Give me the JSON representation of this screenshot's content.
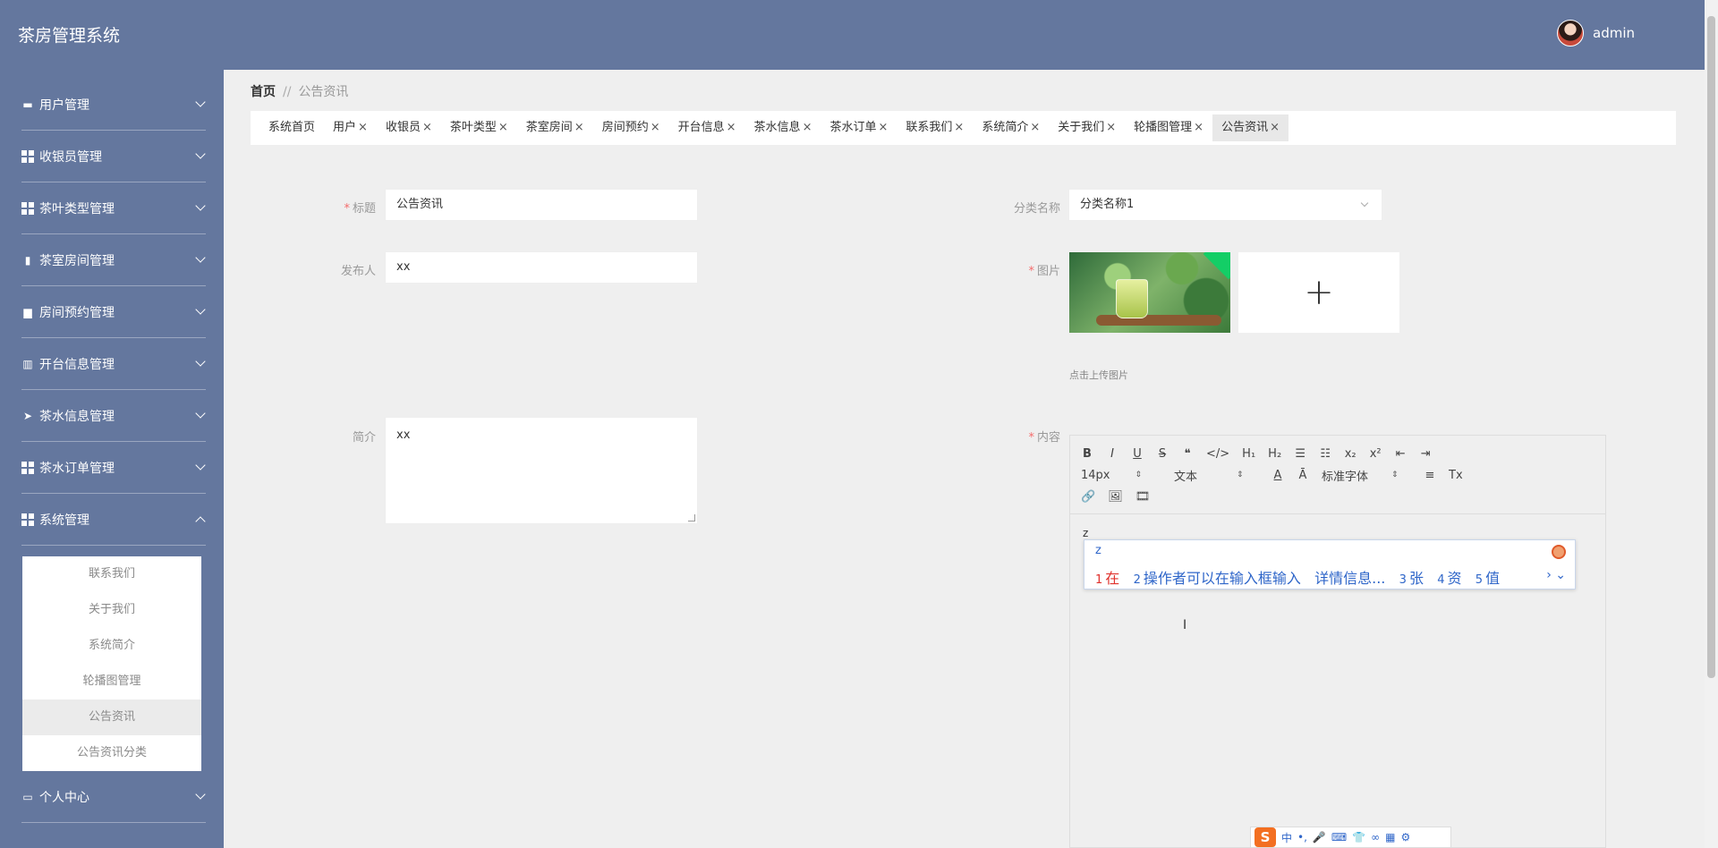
{
  "app": {
    "title": "茶房管理系统"
  },
  "user": {
    "name": "admin"
  },
  "sidebar": {
    "items": [
      {
        "label": "用户管理",
        "icon": "chat-icon"
      },
      {
        "label": "收银员管理",
        "icon": "grid-icon"
      },
      {
        "label": "茶叶类型管理",
        "icon": "grid-icon"
      },
      {
        "label": "茶室房间管理",
        "icon": "bar-chart-icon"
      },
      {
        "label": "房间预约管理",
        "icon": "briefcase-icon"
      },
      {
        "label": "开台信息管理",
        "icon": "books-icon"
      },
      {
        "label": "茶水信息管理",
        "icon": "paper-plane-icon"
      },
      {
        "label": "茶水订单管理",
        "icon": "grid-icon"
      },
      {
        "label": "系统管理",
        "icon": "grid-icon"
      },
      {
        "label": "个人中心",
        "icon": "card-icon"
      }
    ],
    "submenu": [
      "联系我们",
      "关于我们",
      "系统简介",
      "轮播图管理",
      "公告资讯",
      "公告资讯分类"
    ]
  },
  "breadcrumb": {
    "home": "首页",
    "separator": "//",
    "current": "公告资讯"
  },
  "tabs": [
    "系统首页",
    "用户",
    "收银员",
    "茶叶类型",
    "茶室房间",
    "房间预约",
    "开台信息",
    "茶水信息",
    "茶水订单",
    "联系我们",
    "系统简介",
    "关于我们",
    "轮播图管理",
    "公告资讯"
  ],
  "tab_close": "×",
  "form": {
    "title_label": "标题",
    "title_value": "公告资讯",
    "category_label": "分类名称",
    "category_value": "分类名称1",
    "publisher_label": "发布人",
    "publisher_value": "xx",
    "image_label": "图片",
    "upload_tip": "点击上传图片",
    "upload_plus": "+",
    "intro_label": "简介",
    "intro_value": "xx",
    "content_label": "内容",
    "required_mark": "*"
  },
  "editor": {
    "row1": [
      "B",
      "I",
      "U",
      "S",
      "❝",
      "</>",
      "H₁",
      "H₂",
      "☰",
      "☷",
      "x₂",
      "x²",
      "⇤",
      "⇥"
    ],
    "font_size": "14px",
    "format": "文本",
    "font_family": "标准字体",
    "row2_tools": [
      "A",
      "Ā",
      "≡",
      "Tx"
    ],
    "row3": [
      "🔗",
      "🖼",
      "🎞"
    ],
    "content": "z"
  },
  "ime": {
    "input": "z",
    "candidates": [
      {
        "num": "1",
        "text": "在"
      },
      {
        "num": "2",
        "text": "操作者可以在输入框输入"
      },
      {
        "num": "",
        "text": "详情信息..."
      },
      {
        "num": "3",
        "text": "张"
      },
      {
        "num": "4",
        "text": "资"
      },
      {
        "num": "5",
        "text": "值"
      }
    ],
    "nav": "› ⌄",
    "bar": [
      "S",
      "中",
      "•,",
      "🎤",
      "⌨",
      "👕",
      "∞",
      "▦",
      "⚙"
    ]
  },
  "colors": {
    "header": "#64779e",
    "accent_required": "#f56c6c",
    "ime_blue": "#2f66c9"
  }
}
